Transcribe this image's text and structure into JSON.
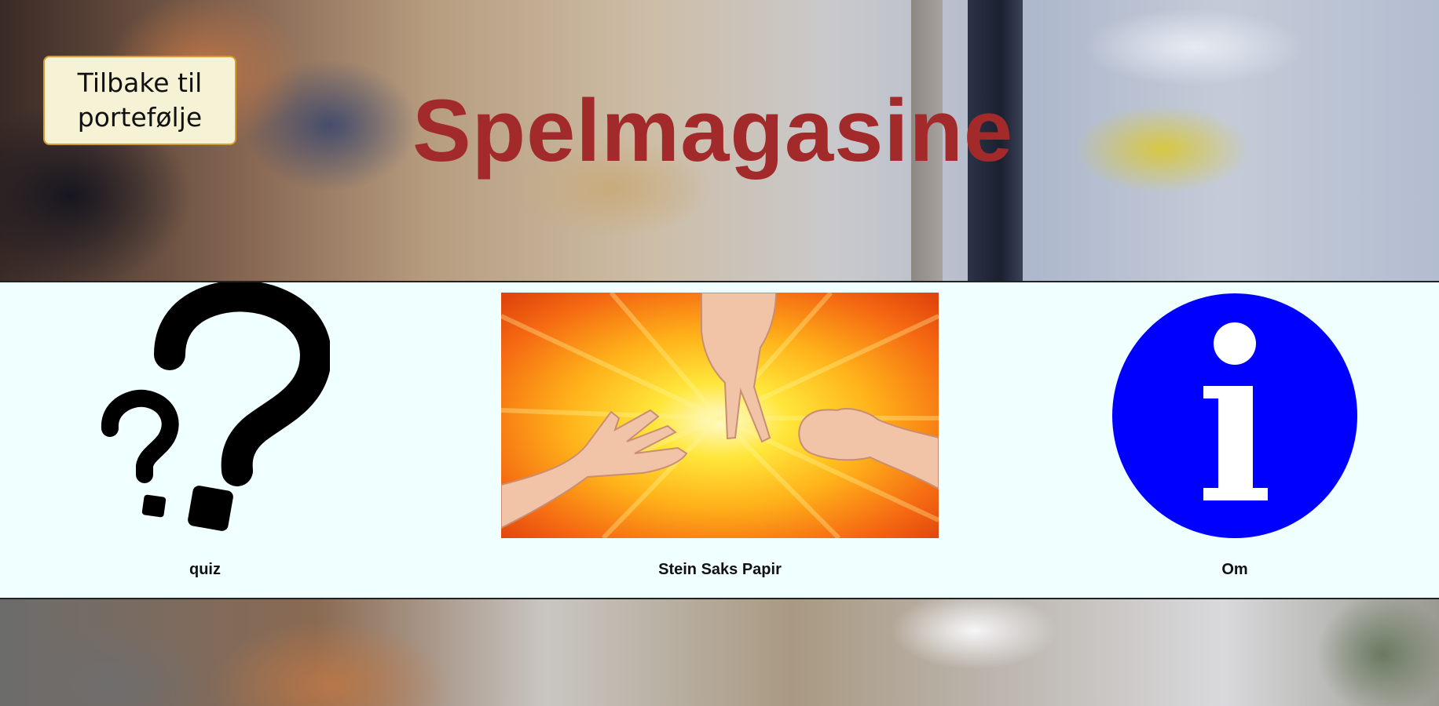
{
  "header": {
    "back_button_label": "Tilbake til portefølje",
    "title": "Spelmagasine"
  },
  "menu": {
    "items": [
      {
        "label": "quiz",
        "icon": "question-marks-icon"
      },
      {
        "label": "Stein Saks Papir",
        "icon": "rock-paper-scissors-image"
      },
      {
        "label": "Om",
        "icon": "info-icon"
      }
    ]
  },
  "colors": {
    "title": "#a22a2a",
    "button_bg": "#f6f2d6",
    "button_border": "#d69a2e",
    "menu_bg": "#f0ffff",
    "info_blue": "#0000ff"
  }
}
